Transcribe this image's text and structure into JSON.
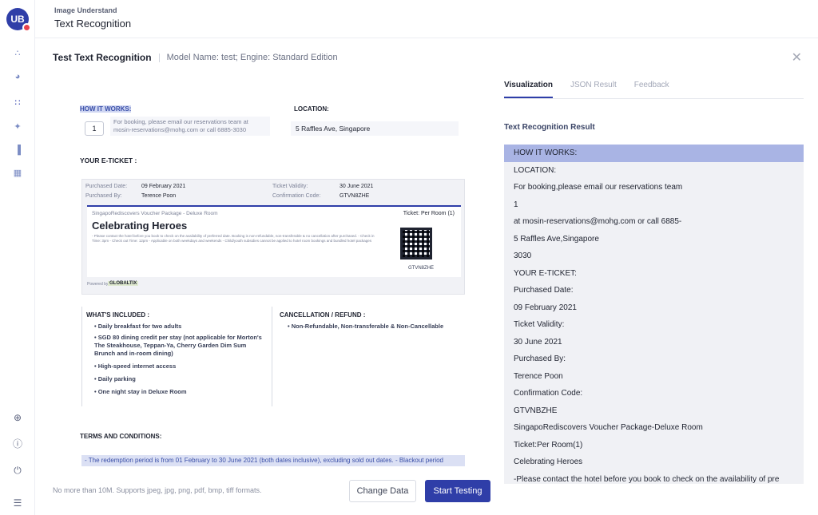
{
  "app": {
    "logo_text": "UB",
    "breadcrumb": "Image Understand",
    "title": "Text Recognition"
  },
  "panel": {
    "heading": "Test Text Recognition",
    "model_label": "Model Name:",
    "model_value": "test;",
    "engine_label": "Engine:",
    "engine_value": "Standard Edition"
  },
  "document": {
    "how_it_works": "HOW IT WORKS:",
    "location_label": "LOCATION:",
    "step_number": "1",
    "booking_text": "For booking, please email our reservations team at mosin-reservations@mohg.com or call 6885-3030",
    "location_value": "5 Raffles Ave, Singapore",
    "eticket_label": "YOUR E-TICKET :",
    "purchased_date_label": "Purchased Date:",
    "purchased_date_value": "09 February 2021",
    "ticket_validity_label": "Ticket Validity:",
    "ticket_validity_value": "30 June 2021",
    "purchased_by_label": "Purchased By:",
    "purchased_by_value": "Terence Poon",
    "confirmation_label": "Confirmation Code:",
    "confirmation_value": "GTVN8ZHE",
    "package_name": "SingapoRediscovers Voucher Package - Deluxe Room",
    "ticket_type": "Ticket: Per Room (1)",
    "event_title": "Celebrating Heroes",
    "fine_print": "- Please contact the hotel before you book to check on the availability of preferred date. Booking is non-refundable, non-transferable & no cancellation after purchased. - Check in Time: 3pm - Check out Time: 12pm - Applicable on both weekdays and weekends - Child/youth subsidies cannot be applied to hotel room bookings and bundled hotel packages",
    "qr_code": "GTVN8ZHE",
    "powered_by": "Powered by",
    "powered_brand": "GLOBALTIX",
    "included_label": "WHAT'S INCLUDED :",
    "included_items": [
      "• Daily breakfast for two adults",
      "• SGD 80 dining credit per stay (not applicable for Morton's The Steakhouse, Teppan-Ya, Cherry Garden Dim Sum Brunch and in-room dining)",
      "• High-speed internet access",
      "• Daily parking",
      "• One night stay in Deluxe Room"
    ],
    "cancellation_label": "CANCELLATION / REFUND :",
    "cancellation_text": "• Non-Refundable, Non-transferable & Non-Cancellable",
    "terms_label": "TERMS AND CONDITIONS:",
    "terms_text": "- The redemption period is from 01 February to 30 June 2021 (both dates inclusive), excluding sold out dates. - Blackout period"
  },
  "footer": {
    "note": "No more than 10M. Supports jpeg, jpg, png, pdf, bmp, tiff formats.",
    "change_button": "Change Data",
    "start_button": "Start Testing"
  },
  "results": {
    "tabs": [
      "Visualization",
      "JSON Result",
      "Feedback"
    ],
    "active_tab": 0,
    "title": "Text Recognition Result",
    "lines": [
      "HOW IT WORKS:",
      "LOCATION:",
      "For booking,please email our reservations team",
      "1",
      "at mosin-reservations@mohg.com or call 6885-",
      "5 Raffles Ave,Singapore",
      "3030",
      "YOUR E-TICKET:",
      "Purchased Date:",
      "09 February 2021",
      "Ticket Validity:",
      "30 June 2021",
      "Purchased By:",
      "Terence Poon",
      "Confirmation Code:",
      "GTVNBZHE",
      "SingapoRediscovers Voucher Package-Deluxe Room",
      "Ticket:Per Room(1)",
      "Celebrating Heroes",
      "-Please contact the hotel before you book to check on the availability of pre"
    ],
    "selected_line": 0
  },
  "colors": {
    "brand": "#2f3ea8",
    "highlight": "#a9b4e4",
    "logo_badge": "#e8424c"
  },
  "icons": {
    "sidebar_top": [
      "nodes-icon",
      "pie-icon",
      "people-icon",
      "sparkle-icon",
      "bar-chart-icon",
      "dashboard-icon"
    ],
    "sidebar_bottom": [
      "globe-icon",
      "help-icon",
      "power-icon",
      "menu-icon"
    ]
  }
}
